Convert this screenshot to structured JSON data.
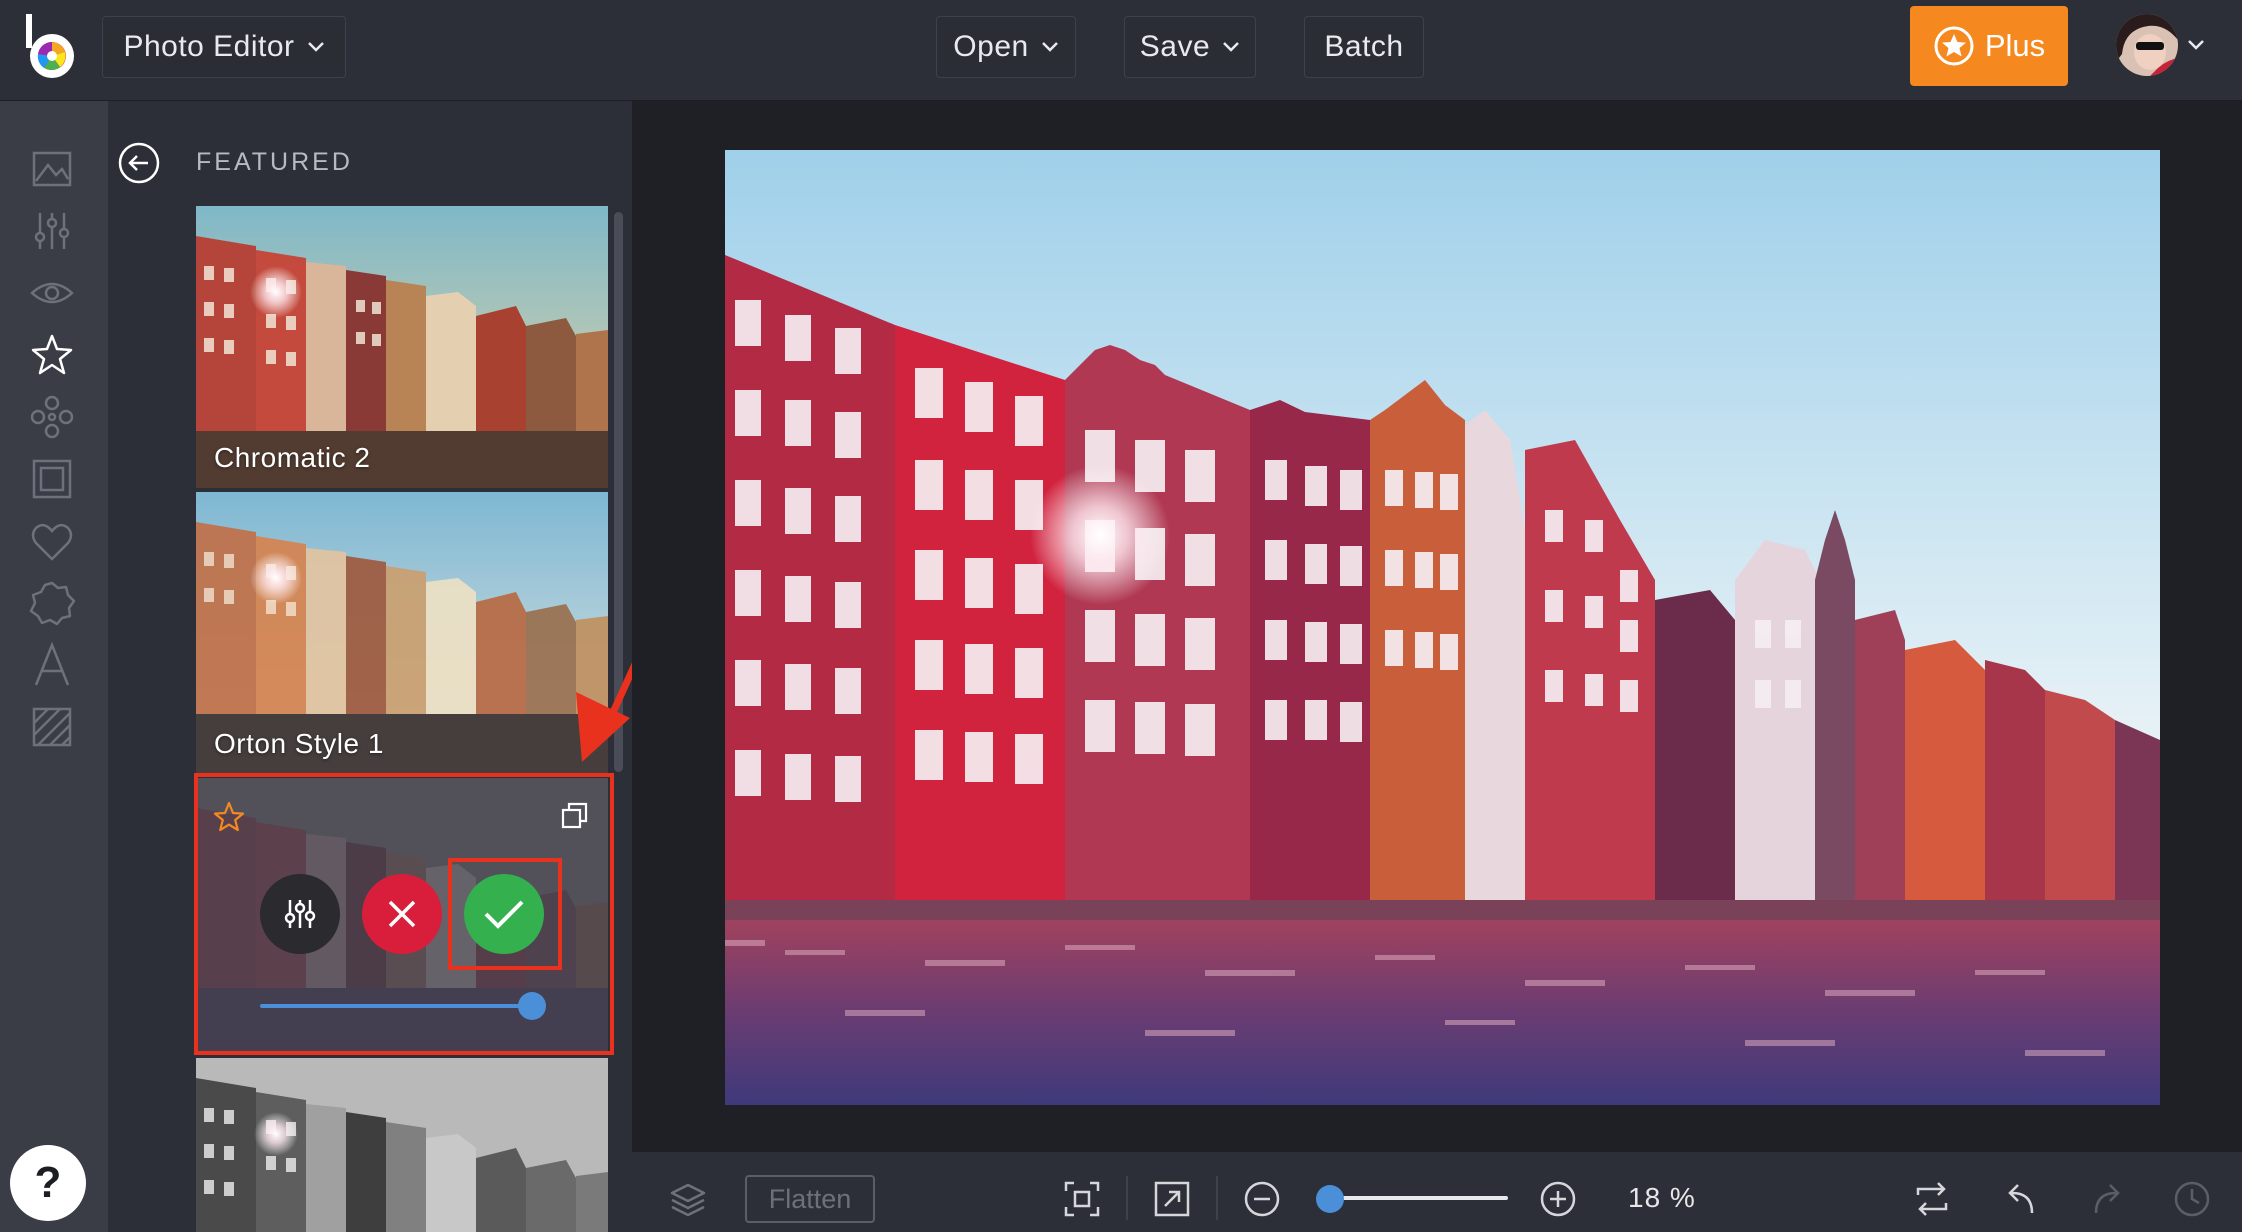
{
  "topbar": {
    "app_menu_label": "Photo Editor",
    "open_label": "Open",
    "save_label": "Save",
    "batch_label": "Batch",
    "plus_label": "Plus"
  },
  "rail": {
    "items": [
      {
        "icon": "image-icon"
      },
      {
        "icon": "sliders-icon"
      },
      {
        "icon": "eye-icon"
      },
      {
        "icon": "star-icon"
      },
      {
        "icon": "graphics-icon"
      },
      {
        "icon": "frame-icon"
      },
      {
        "icon": "heart-icon"
      },
      {
        "icon": "badge-icon"
      },
      {
        "icon": "text-icon"
      },
      {
        "icon": "texture-icon"
      }
    ],
    "help_label": "?"
  },
  "panel": {
    "section_title": "FEATURED",
    "filters": [
      {
        "label": "Chromatic 2"
      },
      {
        "label": "Orton Style 1"
      }
    ],
    "active_filter": {
      "intensity": 1.0
    }
  },
  "bottombar": {
    "flatten_label": "Flatten",
    "zoom_value": "18 %",
    "zoom_fraction": 0.06
  },
  "colors": {
    "accent_orange": "#f5891f",
    "slider_blue": "#4c8fd9",
    "cancel_red": "#d81e3a",
    "apply_green": "#34b04f",
    "highlight_red": "#e8321e"
  }
}
